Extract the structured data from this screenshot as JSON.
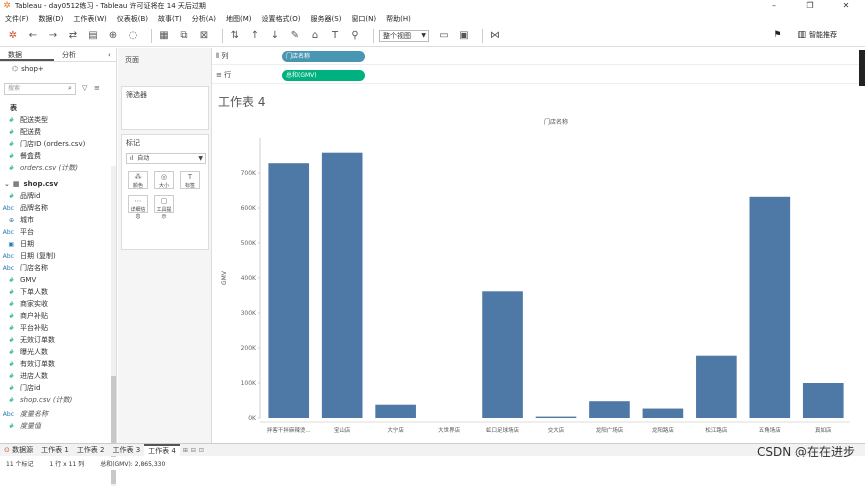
{
  "window": {
    "title": "Tableau - day0512练习 - Tableau 许可证将在 14 天后过期"
  },
  "menu": [
    "文件(F)",
    "数据(D)",
    "工作表(W)",
    "仪表板(B)",
    "故事(T)",
    "分析(A)",
    "地图(M)",
    "设置格式(O)",
    "服务器(S)",
    "窗口(N)",
    "帮助(H)"
  ],
  "toolbar": {
    "fit_label": "整个视图",
    "smart_show_label": "智能推荐"
  },
  "sidebar": {
    "tab_data": "数据",
    "tab_analysis": "分析",
    "datasource": "shop+",
    "search_placeholder": "搜索",
    "table_header": "表",
    "fields_orders": [
      "配送类型",
      "配送费",
      "门店ID (orders.csv)",
      "餐盒费",
      "orders.csv (计数)"
    ],
    "shop_group": "shop.csv",
    "fields_shop_dims": [
      "品牌id",
      "品牌名称",
      "城市",
      "平台",
      "日期",
      "日期 (复制)",
      "门店名称"
    ],
    "fields_shop_meas": [
      "GMV",
      "下单人数",
      "商家实收",
      "商户补贴",
      "平台补贴",
      "无效订单数",
      "曝光人数",
      "有效订单数",
      "进店人数",
      "门店id",
      "shop.csv (计数)"
    ],
    "measure_names": "度量名称",
    "measure_values": "度量值"
  },
  "panes": {
    "pages": "页面",
    "filters": "筛选器",
    "marks": "标记",
    "mark_type": "自动",
    "mark_buttons": [
      "颜色",
      "大小",
      "标签",
      "详细信息",
      "工具提示"
    ]
  },
  "shelves": {
    "columns_label": "列",
    "rows_label": "行",
    "columns_pill": "门店名称",
    "rows_pill": "总和(GMV)"
  },
  "sheet": {
    "title": "工作表 4"
  },
  "chart_data": {
    "type": "bar",
    "title": "门店名称",
    "ylabel": "GMV",
    "categories": [
      "拌客干拌麻辣烫...",
      "宝山店",
      "大宁店",
      "大世界店",
      "虹口足球场店",
      "交大店",
      "龙阳广场店",
      "龙阳路店",
      "松江路店",
      "五角场店",
      "真如店"
    ],
    "values": [
      728000,
      758000,
      38000,
      0,
      362000,
      4000,
      48000,
      27000,
      178000,
      632000,
      100000
    ],
    "ylim": [
      0,
      800000
    ],
    "yticks": [
      "0K",
      "100K",
      "200K",
      "300K",
      "400K",
      "500K",
      "600K",
      "700K"
    ],
    "bar_color": "#4e79a7",
    "grid": false
  },
  "bottom_tabs": {
    "datasource": "数据源",
    "sheets": [
      "工作表 1",
      "工作表 2",
      "工作表 3",
      "工作表 4"
    ]
  },
  "status": {
    "marks": "11 个标记",
    "rows_cols": "1 行 x 11 列",
    "sum": "总和(GMV): 2,865,330"
  },
  "watermark": "CSDN @在在进步"
}
